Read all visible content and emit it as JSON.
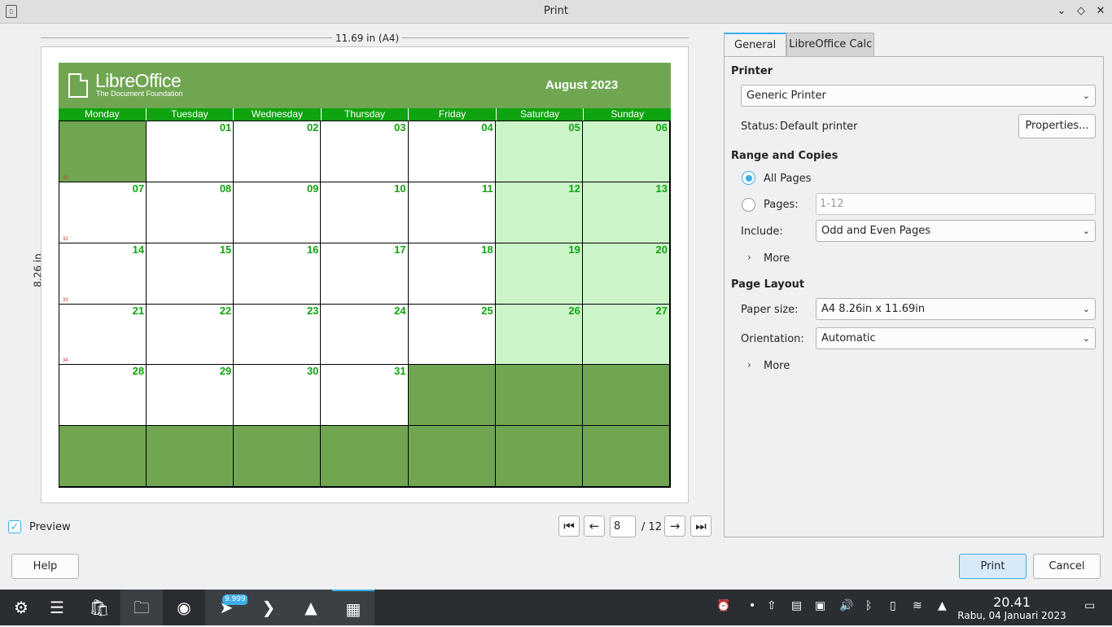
{
  "window": {
    "title": "Print"
  },
  "preview": {
    "width_label": "11.69 in (A4)",
    "height_label": "8.26 in",
    "checkbox_label": "Preview",
    "page_number": "8",
    "page_total": "/ 12"
  },
  "calendar": {
    "brand_name": "LibreOffice",
    "brand_sub": "The Document Foundation",
    "month": "August 2023",
    "days": [
      "Monday",
      "Tuesday",
      "Wednesday",
      "Thursday",
      "Friday",
      "Saturday",
      "Sunday"
    ],
    "cells": [
      [
        "",
        "01",
        "02",
        "03",
        "04",
        "05",
        "06"
      ],
      [
        "07",
        "08",
        "09",
        "10",
        "11",
        "12",
        "13"
      ],
      [
        "14",
        "15",
        "16",
        "17",
        "18",
        "19",
        "20"
      ],
      [
        "21",
        "22",
        "23",
        "24",
        "25",
        "26",
        "27"
      ],
      [
        "28",
        "29",
        "30",
        "31",
        "",
        "",
        ""
      ],
      [
        "",
        "",
        "",
        "",
        "",
        "",
        ""
      ]
    ],
    "week_numbers": [
      "31",
      "32",
      "33",
      "34"
    ]
  },
  "tabs": [
    "General",
    "LibreOffice Calc"
  ],
  "printer": {
    "section": "Printer",
    "selected": "Generic Printer",
    "status_label": "Status:",
    "status_value": "Default printer",
    "properties_button": "Properties..."
  },
  "range": {
    "section": "Range and Copies",
    "all_pages": "All Pages",
    "pages": "Pages:",
    "pages_placeholder": "1-12",
    "include_label": "Include:",
    "include_value": "Odd and Even Pages",
    "more": "More"
  },
  "layout": {
    "section": "Page Layout",
    "paper_label": "Paper size:",
    "paper_value": "A4 8.26in x 11.69in",
    "orientation_label": "Orientation:",
    "orientation_value": "Automatic",
    "more": "More"
  },
  "footer": {
    "help": "Help",
    "print": "Print",
    "cancel": "Cancel"
  },
  "taskbar": {
    "badge": "9.999",
    "time": "20.41",
    "date": "Rabu, 04 Januari 2023"
  }
}
